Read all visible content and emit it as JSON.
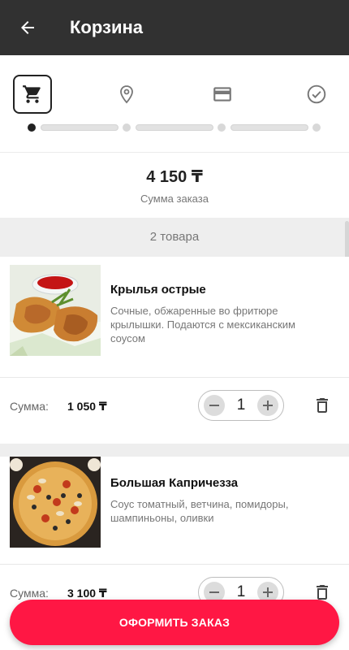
{
  "appbar": {
    "title": "Корзина"
  },
  "steps": {
    "active_index": 0
  },
  "order": {
    "total": "4 150 ₸",
    "total_label": "Сумма заказа",
    "items_count": "2 товара"
  },
  "items": [
    {
      "name": "Крылья острые",
      "description": "Сочные, обжаренные во фритюре крылышки. Подаются с мексиканским соусом",
      "sum_label": "Сумма:",
      "sum": "1 050 ₸",
      "quantity": "1"
    },
    {
      "name": "Большая Капричезза",
      "description": "Соус томатный, ветчина, помидоры, шампиньоны, оливки",
      "sum_label": "Сумма:",
      "sum": "3 100 ₸",
      "quantity": "1"
    }
  ],
  "checkout": {
    "label": "ОФОРМИТЬ ЗАКАЗ"
  },
  "colors": {
    "appbar": "#313131",
    "accent": "#ff1744",
    "band": "#eeeeee"
  },
  "icons": [
    "arrow-left-icon",
    "cart-icon",
    "location-pin-icon",
    "credit-card-icon",
    "check-circle-icon",
    "minus-icon",
    "plus-icon",
    "trash-icon"
  ]
}
